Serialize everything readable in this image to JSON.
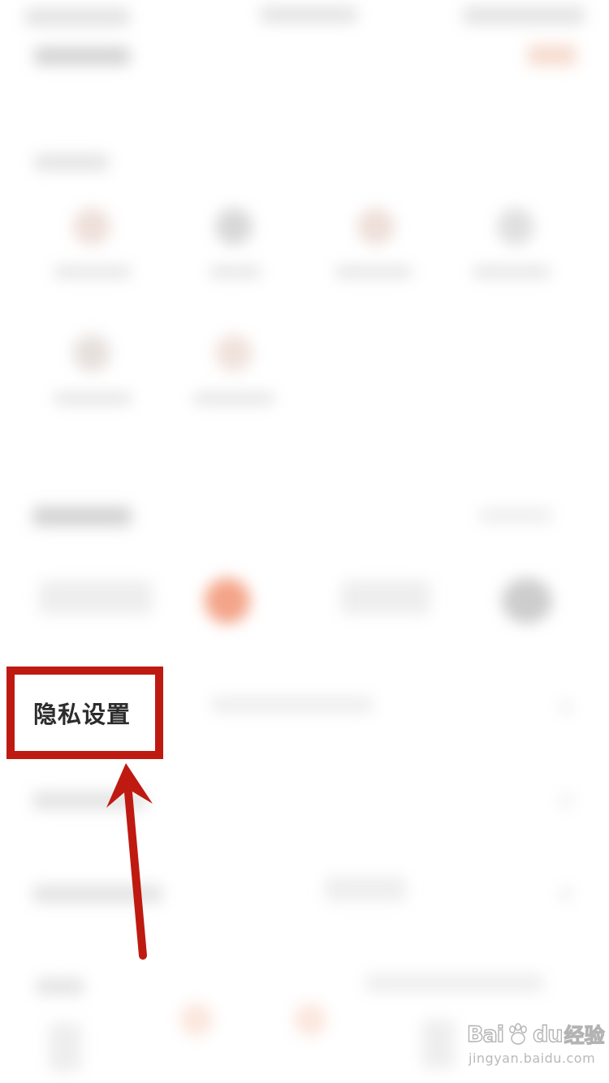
{
  "highlight": {
    "label": "隐私设置"
  },
  "watermark": {
    "brand_prefix": "Bai",
    "brand_suffix": "du",
    "product": "经验",
    "url": "jingyan.baidu.com"
  },
  "colors": {
    "annotation_red": "#be1a11",
    "background": "#ffffff",
    "accent_orange": "#f4a488"
  }
}
